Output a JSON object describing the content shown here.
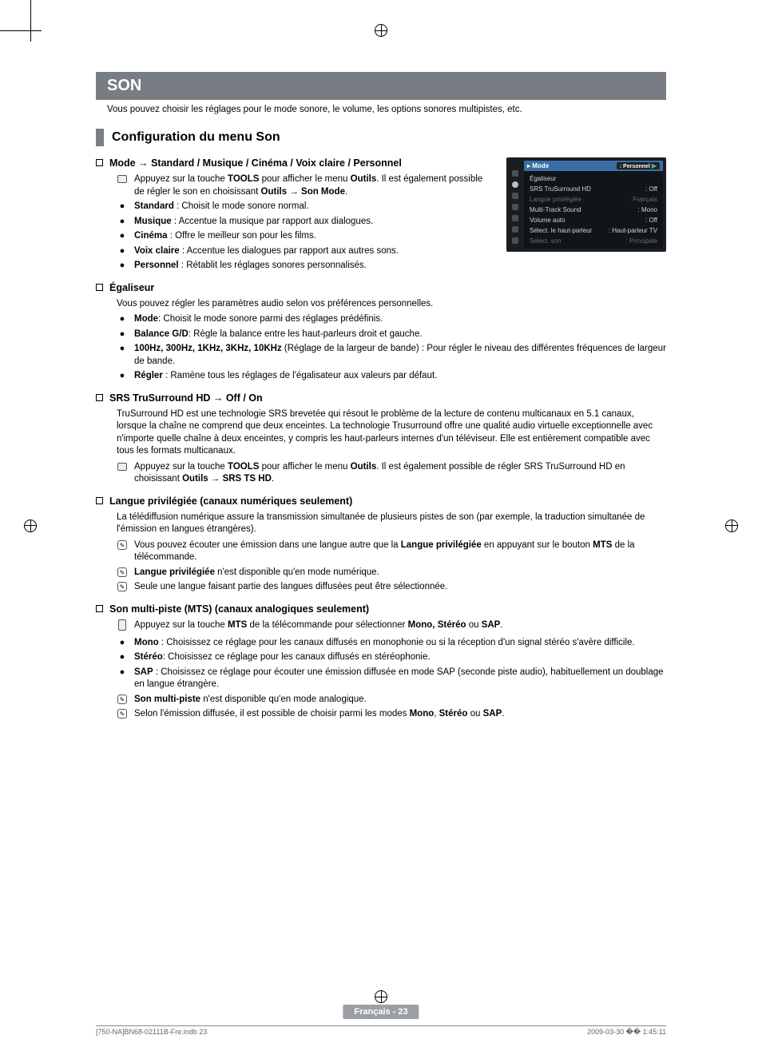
{
  "banner": "SON",
  "intro": "Vous pouvez choisir les réglages pour le mode sonore, le volume, les options sonores multipistes, etc.",
  "config_title": "Configuration du menu Son",
  "osd": {
    "mode_row": {
      "label": "Mode",
      "value": "Personnel"
    },
    "items": [
      {
        "label": "Égaliseur",
        "value": ""
      },
      {
        "label": "SRS TruSurround HD",
        "value": ": Off"
      },
      {
        "label": "Langue privilégiée",
        "value": ": Français",
        "dim": true
      },
      {
        "label": "Multi-Track Sound",
        "value": ": Mono"
      },
      {
        "label": "Volume auto",
        "value": ": Off"
      },
      {
        "label": "Sélect. le haut-parleur",
        "value": ": Haut-parleur TV"
      },
      {
        "label": "Sélect. son",
        "value": ": Principale",
        "dim": true
      }
    ]
  },
  "mode_section": {
    "heading_prefix": "Mode → ",
    "heading_rest": "Standard / Musique / Cinéma / Voix claire / Personnel",
    "tools_line_a": "Appuyez sur la touche ",
    "tools_b1": "TOOLS",
    "tools_line_b": " pour afficher le menu ",
    "tools_b2": "Outils",
    "tools_line_c": ". Il est également possible de régler le son en choisissant ",
    "tools_b3": "Outils → Son Mode",
    "tools_line_d": ".",
    "bullets": [
      {
        "b": "Standard",
        "t": " : Choisit le mode sonore normal."
      },
      {
        "b": "Musique",
        "t": " : Accentue la musique par rapport aux dialogues."
      },
      {
        "b": "Cinéma",
        "t": " : Offre le meilleur son pour les films."
      },
      {
        "b": "Voix claire",
        "t": " : Accentue les dialogues par rapport aux autres sons."
      },
      {
        "b": "Personnel",
        "t": " : Rétablit les réglages sonores personnalisés."
      }
    ]
  },
  "eq_section": {
    "heading": "Égaliseur",
    "intro": "Vous pouvez régler les paramètres audio selon vos préférences personnelles.",
    "bullets": [
      {
        "b": "Mode",
        "t": ": Choisit le mode sonore parmi des réglages prédéfinis."
      },
      {
        "b": "Balance G/D",
        "t": ": Règle la balance entre les haut-parleurs droit et gauche."
      },
      {
        "b": "100Hz, 300Hz, 1KHz, 3KHz, 10KHz",
        "t": " (Réglage de la largeur de bande) : Pour régler le niveau des différentes fréquences de largeur de bande."
      },
      {
        "b": "Régler",
        "t": " : Ramène tous les réglages de l'égalisateur aux valeurs par défaut."
      }
    ]
  },
  "srs_section": {
    "heading": "SRS TruSurround HD → Off / On",
    "para": "TruSurround HD est une technologie SRS brevetée qui résout le problème de la lecture de contenu multicanaux en 5.1 canaux, lorsque la chaîne ne comprend que deux enceintes. La technologie Trusurround offre une qualité audio virtuelle exceptionnelle avec n'importe quelle chaîne à deux enceintes, y compris les haut-parleurs internes d'un téléviseur. Elle est entièrement compatible avec tous les formats multicanaux.",
    "tools_a": "Appuyez sur la touche ",
    "tools_b1": "TOOLS",
    "tools_b": " pour afficher le menu ",
    "tools_b2": "Outils",
    "tools_c": ". Il est également possible de régler SRS TruSurround HD en choisissant ",
    "tools_b3": "Outils → SRS TS HD",
    "tools_d": "."
  },
  "lang_section": {
    "heading": "Langue privilégiée (canaux numériques seulement)",
    "para": "La télédiffusion numérique assure la transmission simultanée de plusieurs pistes de son (par exemple, la traduction simultanée de l'émission en langues étrangères).",
    "n1a": "Vous pouvez écouter une émission dans une langue autre que la ",
    "n1b": "Langue privilégiée",
    "n1c": " en appuyant sur le bouton ",
    "n1d": "MTS",
    "n1e": " de la télécommande.",
    "n2a": "Langue privilégiée",
    "n2b": " n'est disponible qu'en mode numérique.",
    "n3": "Seule une langue faisant partie des langues diffusées peut être sélectionnée."
  },
  "mts_section": {
    "heading": "Son multi-piste (MTS) (canaux analogiques seulement)",
    "r1a": "Appuyez sur la touche ",
    "r1b": "MTS",
    "r1c": " de la télécommande pour sélectionner ",
    "r1d": "Mono, Stéréo",
    "r1e": " ou ",
    "r1f": "SAP",
    "r1g": ".",
    "bullets": [
      {
        "b": "Mono",
        "t": " : Choisissez ce réglage pour les canaux diffusés en monophonie ou si la réception d'un signal stéréo s'avère difficile."
      },
      {
        "b": "Stéréo",
        "t": ": Choisissez ce réglage pour les canaux diffusés en stéréophonie."
      },
      {
        "b": "SAP",
        "t": " : Choisissez ce réglage pour écouter une émission diffusée en mode SAP (seconde piste audio), habituellement un doublage en langue étrangère."
      }
    ],
    "n1a": "Son multi-piste",
    "n1b": " n'est disponible qu'en mode analogique.",
    "n2a": "Selon l'émission diffusée, il est possible de choisir parmi les modes ",
    "n2b": "Mono",
    "n2c": ", ",
    "n2d": "Stéréo",
    "n2e": " ou ",
    "n2f": "SAP",
    "n2g": "."
  },
  "footer": "Français - 23",
  "bottom_left": "[750-NA]BN68-02111B-Fre.indb   23",
  "bottom_right": "2009-03-30   �� 1:45:11"
}
